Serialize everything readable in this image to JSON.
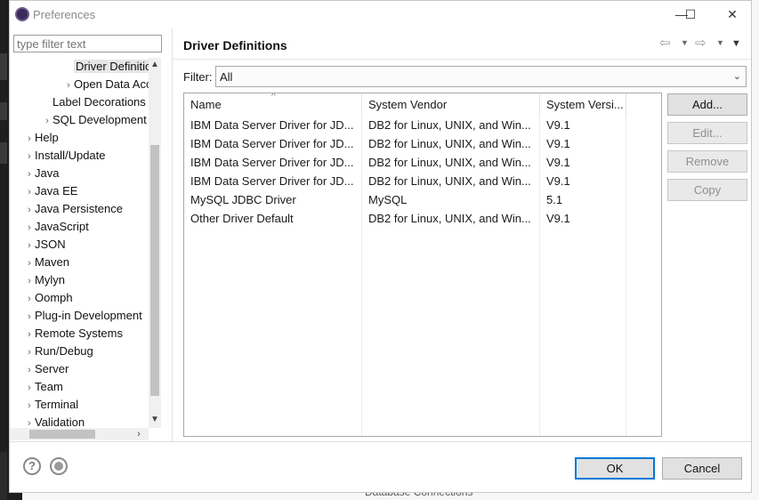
{
  "window": {
    "title": "Preferences",
    "minimize": "—",
    "maximize": "☐",
    "close": "✕"
  },
  "background": {
    "bottom_text": "Database Connections"
  },
  "filter": {
    "placeholder": "type filter text",
    "value": ""
  },
  "tree": {
    "items": [
      {
        "label": "Driver Definitio",
        "level": 2,
        "arrow": "",
        "selected": true
      },
      {
        "label": "Open Data Acc",
        "level": 2,
        "arrow": "›",
        "selected": false
      },
      {
        "label": "Label Decorations",
        "level": 1,
        "arrow": "",
        "selected": false
      },
      {
        "label": "SQL Development",
        "level": 1,
        "arrow": "›",
        "selected": false
      },
      {
        "label": "Help",
        "level": 0,
        "arrow": "›",
        "selected": false
      },
      {
        "label": "Install/Update",
        "level": 0,
        "arrow": "›",
        "selected": false
      },
      {
        "label": "Java",
        "level": 0,
        "arrow": "›",
        "selected": false
      },
      {
        "label": "Java EE",
        "level": 0,
        "arrow": "›",
        "selected": false
      },
      {
        "label": "Java Persistence",
        "level": 0,
        "arrow": "›",
        "selected": false
      },
      {
        "label": "JavaScript",
        "level": 0,
        "arrow": "›",
        "selected": false
      },
      {
        "label": "JSON",
        "level": 0,
        "arrow": "›",
        "selected": false
      },
      {
        "label": "Maven",
        "level": 0,
        "arrow": "›",
        "selected": false
      },
      {
        "label": "Mylyn",
        "level": 0,
        "arrow": "›",
        "selected": false
      },
      {
        "label": "Oomph",
        "level": 0,
        "arrow": "›",
        "selected": false
      },
      {
        "label": "Plug-in Development",
        "level": 0,
        "arrow": "›",
        "selected": false
      },
      {
        "label": "Remote Systems",
        "level": 0,
        "arrow": "›",
        "selected": false
      },
      {
        "label": "Run/Debug",
        "level": 0,
        "arrow": "›",
        "selected": false
      },
      {
        "label": "Server",
        "level": 0,
        "arrow": "›",
        "selected": false
      },
      {
        "label": "Team",
        "level": 0,
        "arrow": "›",
        "selected": false
      },
      {
        "label": "Terminal",
        "level": 0,
        "arrow": "›",
        "selected": false
      },
      {
        "label": "Validation",
        "level": 0,
        "arrow": "›",
        "selected": false
      }
    ]
  },
  "page": {
    "title": "Driver Definitions",
    "filter_label": "Filter:",
    "filter_value": "All",
    "columns": [
      "Name",
      "System Vendor",
      "System Versi..."
    ],
    "rows": [
      [
        "IBM Data Server Driver for JD...",
        "DB2 for Linux, UNIX, and Win...",
        "V9.1"
      ],
      [
        "IBM Data Server Driver for JD...",
        "DB2 for Linux, UNIX, and Win...",
        "V9.1"
      ],
      [
        "IBM Data Server Driver for JD...",
        "DB2 for Linux, UNIX, and Win...",
        "V9.1"
      ],
      [
        "IBM Data Server Driver for JD...",
        "DB2 for Linux, UNIX, and Win...",
        "V9.1"
      ],
      [
        "MySQL JDBC Driver",
        "MySQL",
        "5.1"
      ],
      [
        "Other Driver Default",
        "DB2 for Linux, UNIX, and Win...",
        "V9.1"
      ]
    ],
    "buttons": {
      "add": "Add...",
      "edit": "Edit...",
      "remove": "Remove",
      "copy": "Copy"
    }
  },
  "footer": {
    "ok": "OK",
    "cancel": "Cancel"
  }
}
